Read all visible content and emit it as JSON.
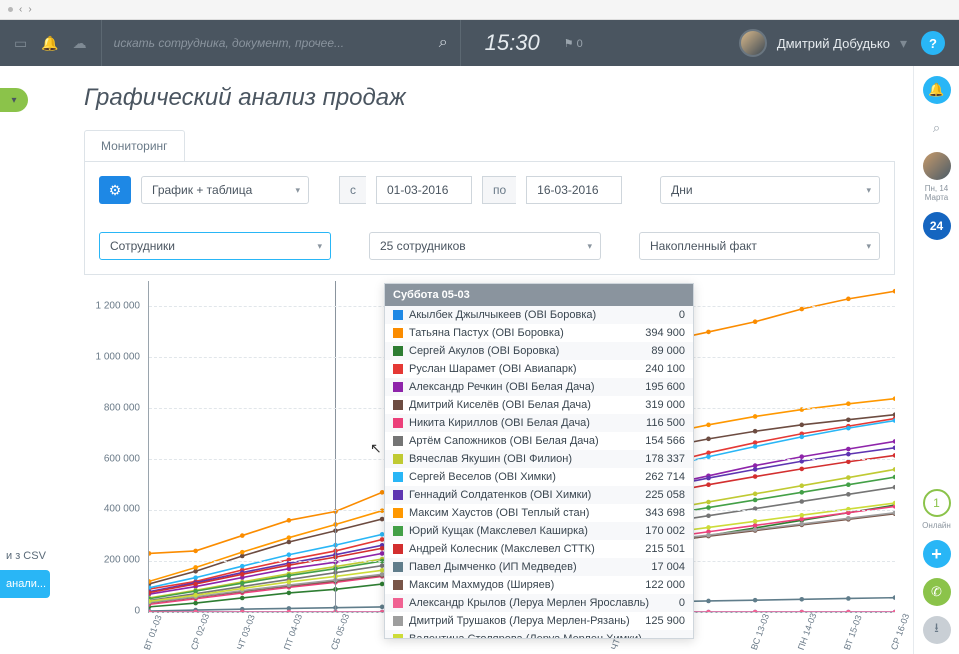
{
  "header": {
    "search_placeholder": "искать сотрудника, документ, прочее...",
    "time": "15:30",
    "flag_count": "0",
    "username": "Дмитрий Добудько",
    "help": "?"
  },
  "page_title": "Графический анализ продаж",
  "tab": "Мониторинг",
  "controls": {
    "view_mode": "График + таблица",
    "from_lbl": "с",
    "from": "01-03-2016",
    "to_lbl": "по",
    "to": "16-03-2016",
    "period": "Дни",
    "subject": "Сотрудники",
    "count": "25 сотрудников",
    "metric": "Накопленный факт"
  },
  "left_cut": {
    "csv": "и з CSV",
    "active": "анали...",
    "other": ""
  },
  "right_rail": {
    "date": "Пн, 14 Марта",
    "badge": "24",
    "online_n": "1",
    "online_lbl": "Онлайн"
  },
  "chart_data": {
    "type": "line",
    "xlabel": "",
    "ylabel": "",
    "ylim": [
      0,
      1300000
    ],
    "y_ticks": [
      0,
      200000,
      400000,
      600000,
      800000,
      1000000,
      1200000
    ],
    "y_tick_labels": [
      "0",
      "200 000",
      "400 000",
      "600 000",
      "800 000",
      "1 000 000",
      "1 200 000"
    ],
    "categories": [
      "ВТ 01-03",
      "СР 02-03",
      "ЧТ 03-03",
      "ПТ 04-03",
      "СБ 05-03",
      "",
      "",
      "",
      "",
      "",
      "ЧТ 10-03",
      "",
      "",
      "ВС 13-03",
      "ПН 14-03",
      "ВТ 15-03",
      "СР 16-03"
    ],
    "tooltip_title": "Суббота 05-03",
    "series": [
      {
        "name": "Акылбек Джылчыкеев (OBI Боровка)",
        "color": "#1e88e5",
        "value_at_tooltip": 0,
        "values": [
          0,
          0,
          0,
          0,
          0,
          0,
          0,
          0,
          0,
          0,
          0,
          0,
          0,
          0,
          0,
          0,
          0
        ]
      },
      {
        "name": "Татьяна Пастух (OBI Боровка)",
        "color": "#fb8c00",
        "value_at_tooltip": 394900,
        "values": [
          230000,
          240000,
          300000,
          360000,
          394900,
          470000,
          560000,
          700000,
          820000,
          940000,
          1010000,
          1060000,
          1100000,
          1140000,
          1190000,
          1230000,
          1260000
        ]
      },
      {
        "name": "Сергей Акулов (OBI Боровка)",
        "color": "#2e7d32",
        "value_at_tooltip": 89000,
        "values": [
          20000,
          35000,
          55000,
          75000,
          89000,
          110000,
          135000,
          160000,
          185000,
          210000,
          240000,
          270000,
          300000,
          330000,
          360000,
          390000,
          420000
        ]
      },
      {
        "name": "Руслан Шарамет (OBI Авиапарк)",
        "color": "#e53935",
        "value_at_tooltip": 240100,
        "values": [
          90000,
          120000,
          165000,
          205000,
          240100,
          285000,
          330000,
          380000,
          430000,
          480000,
          530000,
          580000,
          625000,
          665000,
          700000,
          730000,
          760000
        ]
      },
      {
        "name": "Александр Речкин (OBI Белая Дача)",
        "color": "#8e24aa",
        "value_at_tooltip": 195600,
        "values": [
          70000,
          100000,
          135000,
          170000,
          195600,
          230000,
          270000,
          315000,
          360000,
          405000,
          450000,
          495000,
          535000,
          575000,
          610000,
          640000,
          670000
        ]
      },
      {
        "name": "Дмитрий Киселёв (OBI Белая Дача)",
        "color": "#6d4c41",
        "value_at_tooltip": 319000,
        "values": [
          110000,
          160000,
          220000,
          275000,
          319000,
          365000,
          415000,
          465000,
          515000,
          560000,
          605000,
          645000,
          680000,
          710000,
          735000,
          755000,
          775000
        ]
      },
      {
        "name": "Никита Кириллов (OBI Белая Дача)",
        "color": "#ec407a",
        "value_at_tooltip": 116500,
        "values": [
          30000,
          52000,
          75000,
          97000,
          116500,
          140000,
          165000,
          190000,
          215000,
          240000,
          265000,
          290000,
          315000,
          340000,
          365000,
          390000,
          415000
        ]
      },
      {
        "name": "Артём Сапожников (OBI Белая Дача)",
        "color": "#757575",
        "value_at_tooltip": 154566,
        "values": [
          45000,
          72000,
          100000,
          128000,
          154566,
          182000,
          210000,
          238000,
          266000,
          294000,
          322000,
          350000,
          378000,
          406000,
          434000,
          462000,
          490000
        ]
      },
      {
        "name": "Вячеслав Якушин (OBI Филион)",
        "color": "#c0ca33",
        "value_at_tooltip": 178337,
        "values": [
          55000,
          85000,
          118000,
          150000,
          178337,
          208000,
          240000,
          272000,
          304000,
          336000,
          368000,
          400000,
          432000,
          464000,
          496000,
          528000,
          560000
        ]
      },
      {
        "name": "Сергей Веселов (OBI Химки)",
        "color": "#29b6f6",
        "value_at_tooltip": 262714,
        "values": [
          95000,
          135000,
          180000,
          225000,
          262714,
          305000,
          348000,
          392000,
          436000,
          480000,
          524000,
          568000,
          610000,
          650000,
          688000,
          722000,
          752000
        ]
      },
      {
        "name": "Геннадий Солдатенков (OBI Химки)",
        "color": "#5e35b1",
        "value_at_tooltip": 225058,
        "values": [
          80000,
          115000,
          155000,
          192000,
          225058,
          262000,
          300000,
          338000,
          376000,
          414000,
          452000,
          490000,
          526000,
          560000,
          592000,
          620000,
          645000
        ]
      },
      {
        "name": "Максим Хаустов (OBI Теплый стан)",
        "color": "#ff9800",
        "value_at_tooltip": 343698,
        "values": [
          120000,
          175000,
          235000,
          292000,
          343698,
          398000,
          452000,
          506000,
          558000,
          608000,
          655000,
          698000,
          735000,
          768000,
          795000,
          818000,
          838000
        ]
      },
      {
        "name": "Юрий Кущак (Макслевел Каширка)",
        "color": "#43a047",
        "value_at_tooltip": 170002,
        "values": [
          52000,
          82000,
          113000,
          143000,
          170002,
          200000,
          230000,
          260000,
          290000,
          320000,
          350000,
          380000,
          410000,
          440000,
          470000,
          500000,
          530000
        ]
      },
      {
        "name": "Андрей Колесник (Макслевел СТТК)",
        "color": "#d32f2f",
        "value_at_tooltip": 215501,
        "values": [
          76000,
          110000,
          148000,
          184000,
          215501,
          250000,
          286000,
          322000,
          358000,
          394000,
          430000,
          466000,
          500000,
          532000,
          562000,
          590000,
          615000
        ]
      },
      {
        "name": "Павел Дымченко (ИП Медведев)",
        "color": "#607d8b",
        "value_at_tooltip": 17004,
        "values": [
          4000,
          7500,
          11000,
          14200,
          17004,
          20200,
          23500,
          26800,
          30100,
          33400,
          36700,
          40000,
          43300,
          46600,
          49900,
          53200,
          56500
        ]
      },
      {
        "name": "Максим Махмудов (Ширяев)",
        "color": "#795548",
        "value_at_tooltip": 122000,
        "values": [
          36000,
          58000,
          81000,
          103000,
          122000,
          144000,
          166000,
          188000,
          210000,
          232000,
          254000,
          276000,
          298000,
          320000,
          342000,
          364000,
          386000
        ]
      },
      {
        "name": "Александр Крылов (Леруа Мерлен Ярославль)",
        "color": "#f06292",
        "value_at_tooltip": 0,
        "values": [
          0,
          0,
          0,
          0,
          0,
          0,
          0,
          0,
          0,
          0,
          0,
          0,
          0,
          0,
          0,
          0,
          0
        ]
      },
      {
        "name": "Дмитрий Трушаков (Леруа Мерлен-Рязань)",
        "color": "#9e9e9e",
        "value_at_tooltip": 125900,
        "values": [
          38000,
          60000,
          84000,
          106000,
          125900,
          148000,
          170000,
          192000,
          214000,
          236000,
          258000,
          280000,
          302000,
          324000,
          346000,
          368000,
          390000
        ]
      },
      {
        "name": "Валентина Столярова (Леруа Мерлен Химки)",
        "color": "#cddc39",
        "value_at_tooltip": null,
        "values": [
          42000,
          66000,
          92000,
          118000,
          140000,
          164000,
          188000,
          212000,
          236000,
          260000,
          284000,
          308000,
          332000,
          356000,
          380000,
          404000,
          428000
        ]
      }
    ]
  }
}
